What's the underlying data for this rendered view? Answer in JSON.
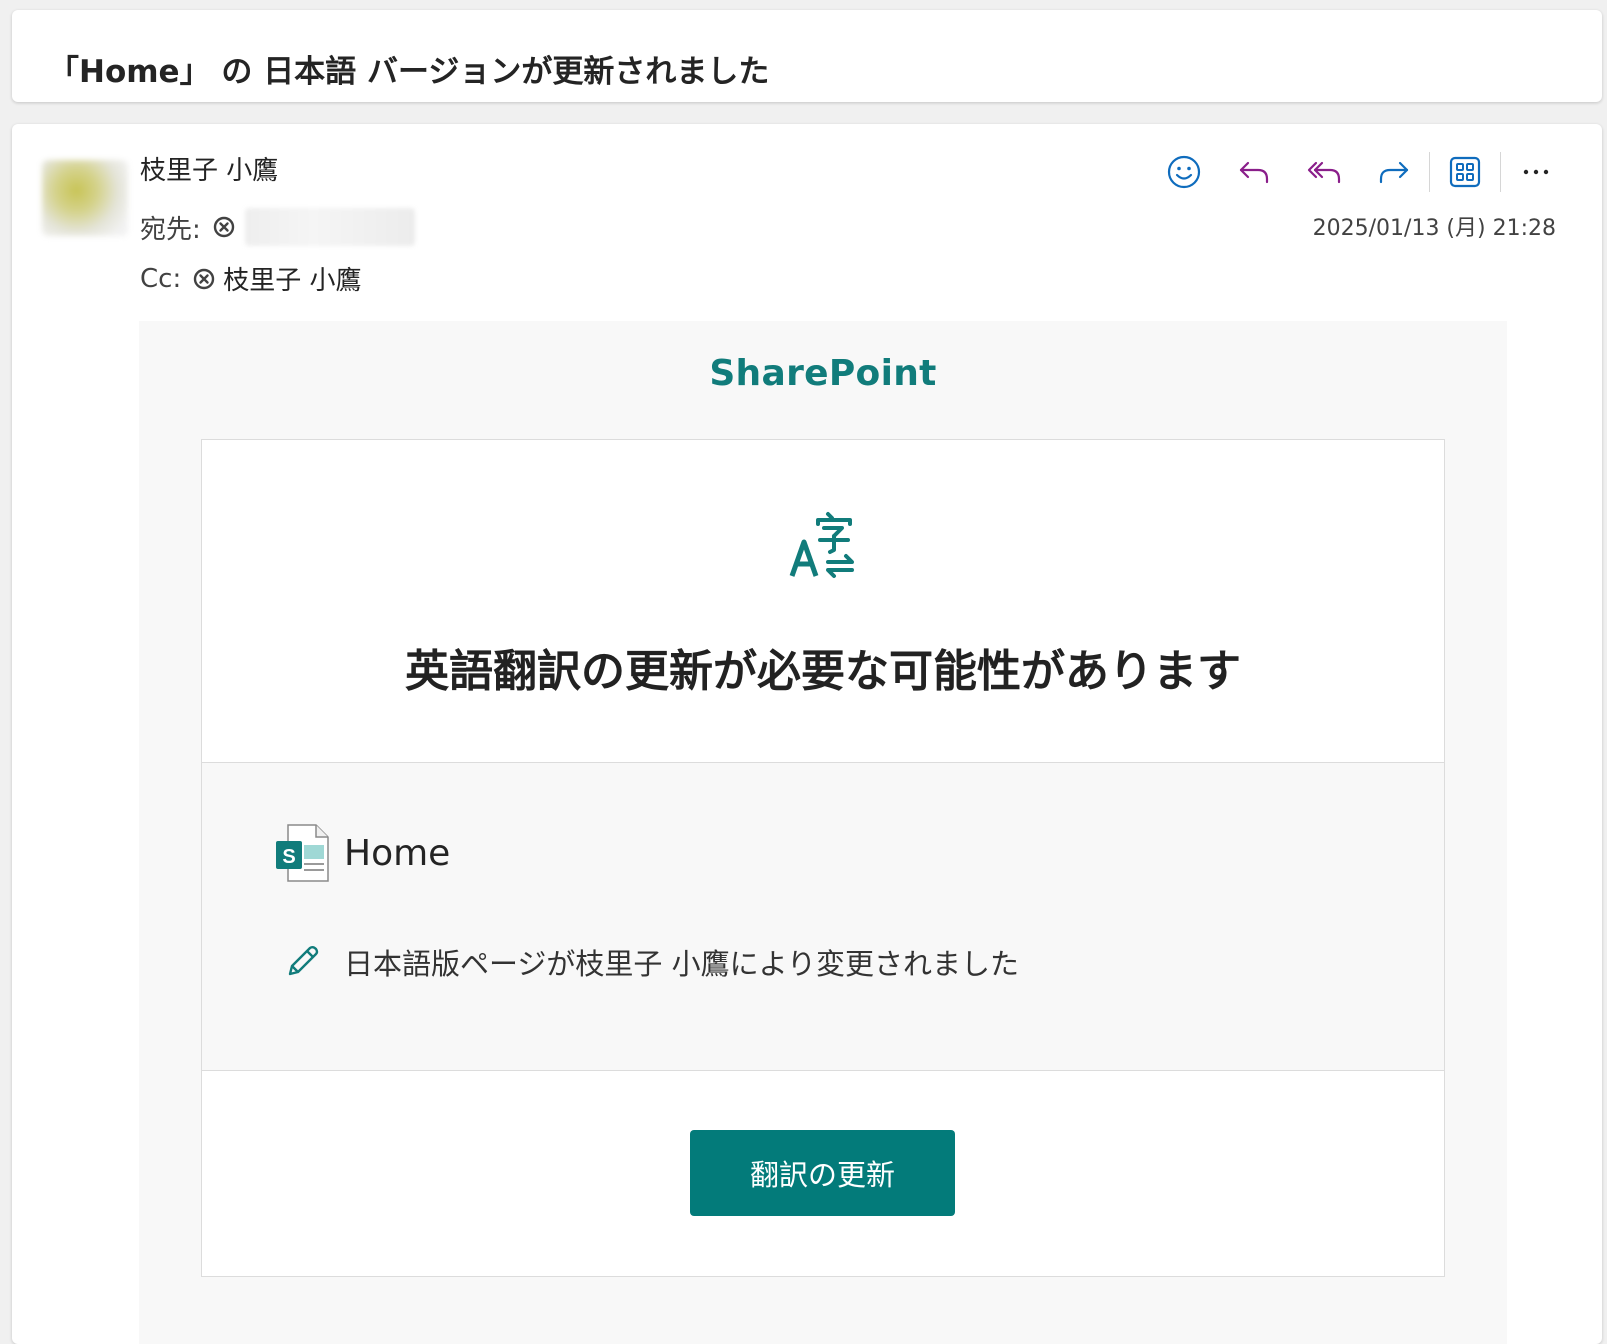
{
  "subject": "「Home」 の 日本語 バージョンが更新されました",
  "header": {
    "sender": "枝里子 小鷹",
    "to_label": "宛先:",
    "cc_label": "Cc:",
    "cc_recipient": "枝里子 小鷹",
    "date": "2025/01/13 (月) 21:28",
    "actions": [
      "smiley-icon",
      "reply-icon",
      "reply-all-icon",
      "forward-icon",
      "apps-icon",
      "more-icon"
    ]
  },
  "body": {
    "brand": "SharePoint",
    "headline": "英語翻訳の更新が必要な可能性があります",
    "page_name": "Home",
    "change_text": "日本語版ページが枝里子 小鷹により変更されました",
    "button_label": "翻訳の更新",
    "accent_color": "#037b7a"
  }
}
